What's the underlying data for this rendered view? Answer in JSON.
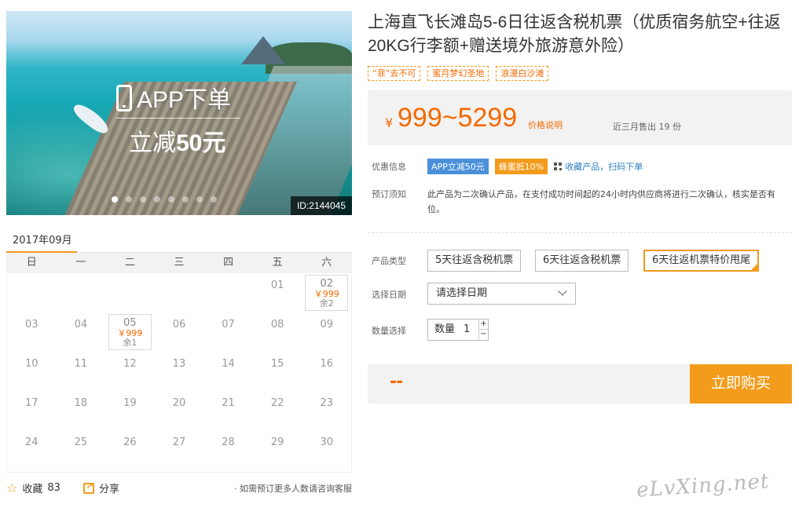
{
  "hero": {
    "promo_line1": "APP下单",
    "promo_line2_prefix": "立减",
    "promo_line2_bold": "50元",
    "id_tag": "ID:2144045"
  },
  "calendar": {
    "month": "2017年09月",
    "weekdays": [
      "日",
      "一",
      "二",
      "三",
      "四",
      "五",
      "六"
    ],
    "days": [
      {
        "d": ""
      },
      {
        "d": ""
      },
      {
        "d": ""
      },
      {
        "d": ""
      },
      {
        "d": ""
      },
      {
        "d": "01"
      },
      {
        "d": "02",
        "price": "￥999",
        "left": "余2"
      },
      {
        "d": "03"
      },
      {
        "d": "04"
      },
      {
        "d": "05",
        "price": "￥999",
        "left": "余1"
      },
      {
        "d": "06"
      },
      {
        "d": "07"
      },
      {
        "d": "08"
      },
      {
        "d": "09"
      },
      {
        "d": "10"
      },
      {
        "d": "11"
      },
      {
        "d": "12"
      },
      {
        "d": "13"
      },
      {
        "d": "14"
      },
      {
        "d": "15"
      },
      {
        "d": "16"
      },
      {
        "d": "17"
      },
      {
        "d": "18"
      },
      {
        "d": "19"
      },
      {
        "d": "20"
      },
      {
        "d": "21"
      },
      {
        "d": "22"
      },
      {
        "d": "23"
      },
      {
        "d": "24"
      },
      {
        "d": "25"
      },
      {
        "d": "26"
      },
      {
        "d": "27"
      },
      {
        "d": "28"
      },
      {
        "d": "29"
      },
      {
        "d": "30"
      }
    ]
  },
  "footer": {
    "favorite_label": "收藏",
    "favorite_count": "83",
    "share_label": "分享",
    "tip": "· 如需预订更多人数请咨询客服"
  },
  "product": {
    "title": "上海直飞长滩岛5-6日往返含税机票（优质宿务航空+往返20KG行李额+赠送境外旅游意外险）",
    "tags": [
      "“菲”去不可",
      "蜜月梦幻圣地",
      "浪漫白沙滩"
    ],
    "price_symbol": "¥",
    "price_range": "999~5299",
    "price_explain": "价格说明",
    "sold": "近三月售出 19 份",
    "offer_label": "优惠信息",
    "offer_badges": [
      "APP立减50元",
      "蜂蜜抵10%"
    ],
    "offer_qr": "收藏产品，扫码下单",
    "notice_label": "预订须知",
    "notice_text": "此产品为二次确认产品，在支付成功时间起的24小时内供应商将进行二次确认，核实是否有位。",
    "type_label": "产品类型",
    "types": [
      "5天往返含税机票",
      "6天往返含税机票",
      "6天往返机票特价甩尾"
    ],
    "date_label": "选择日期",
    "date_placeholder": "请选择日期",
    "qty_label": "数量选择",
    "qty_prefix": "数量",
    "qty_value": "1",
    "qty_plus": "+",
    "qty_minus": "−",
    "total_placeholder": "--",
    "buy_label": "立即购买"
  },
  "watermark": "eLvXing.net",
  "colors": {
    "accent": "#f39b1b",
    "price": "#f56a00",
    "app_badge": "#4a90d9"
  }
}
